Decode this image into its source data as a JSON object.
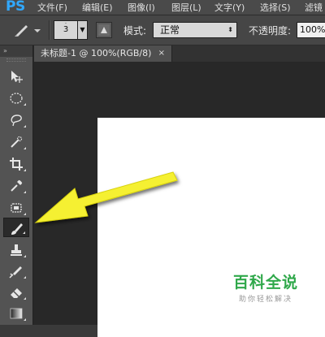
{
  "app": {
    "logo": "PS"
  },
  "menubar": {
    "items": [
      "文件(F)",
      "编辑(E)",
      "图像(I)",
      "图层(L)",
      "文字(Y)",
      "选择(S)",
      "滤镜"
    ]
  },
  "options": {
    "brush_size": "3",
    "size_dropdown_icon": "chevron-down-icon",
    "mode_label": "模式:",
    "mode_value": "正常",
    "opacity_label": "不透明度:",
    "opacity_value": "100%"
  },
  "document": {
    "tab_title": "未标题-1 @ 100%(RGB/8)",
    "tab_close": "×",
    "canvas_color": "#ffffff"
  },
  "toolbox": {
    "collapse": "»",
    "tools": [
      {
        "name": "move-tool",
        "icon": "move-icon"
      },
      {
        "name": "marquee-tool",
        "icon": "elliptical-marquee-icon"
      },
      {
        "name": "lasso-tool",
        "icon": "lasso-icon"
      },
      {
        "name": "quick-selection-tool",
        "icon": "quick-selection-icon"
      },
      {
        "name": "crop-tool",
        "icon": "crop-icon"
      },
      {
        "name": "eyedropper-tool",
        "icon": "eyedropper-icon"
      },
      {
        "name": "healing-brush-tool",
        "icon": "healing-brush-icon"
      },
      {
        "name": "brush-tool",
        "icon": "brush-icon",
        "active": true
      },
      {
        "name": "clone-stamp-tool",
        "icon": "clone-stamp-icon"
      },
      {
        "name": "history-brush-tool",
        "icon": "history-brush-icon"
      },
      {
        "name": "eraser-tool",
        "icon": "eraser-icon"
      },
      {
        "name": "gradient-tool",
        "icon": "gradient-icon"
      }
    ]
  },
  "annotation": {
    "arrow_color": "#f5f030",
    "points_to": "brush-tool"
  },
  "watermark": {
    "main": "百科全说",
    "sub": "助你轻松解决",
    "color": "#2fa84a"
  },
  "colors": {
    "ps_blue": "#31a8ff",
    "workspace": "#282828",
    "panel": "#535353"
  }
}
